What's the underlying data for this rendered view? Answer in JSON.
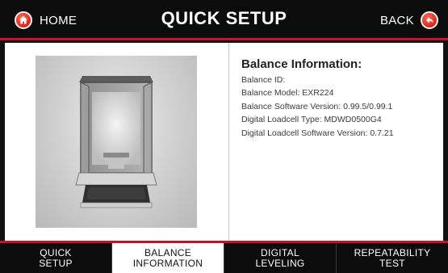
{
  "header": {
    "title": "QUICK SETUP",
    "home_label": "HOME",
    "back_label": "BACK",
    "accent_color": "#c8102e"
  },
  "product_image": {
    "alt": ""
  },
  "info": {
    "heading": "Balance Information:",
    "lines": [
      "Balance ID:",
      "Balance Model:  EXR224",
      "Balance Software Version:  0.99.5/0.99.1",
      "Digital Loadcell Type:  MDWD0500G4",
      "Digital Loadcell Software Version:  0.7.21"
    ]
  },
  "tabs": [
    {
      "label": "QUICK\nSETUP",
      "active": false
    },
    {
      "label": "BALANCE\nINFORMATION",
      "active": true
    },
    {
      "label": "DIGITAL\nLEVELING",
      "active": false
    },
    {
      "label": "REPEATABILITY\nTEST",
      "active": false
    }
  ]
}
